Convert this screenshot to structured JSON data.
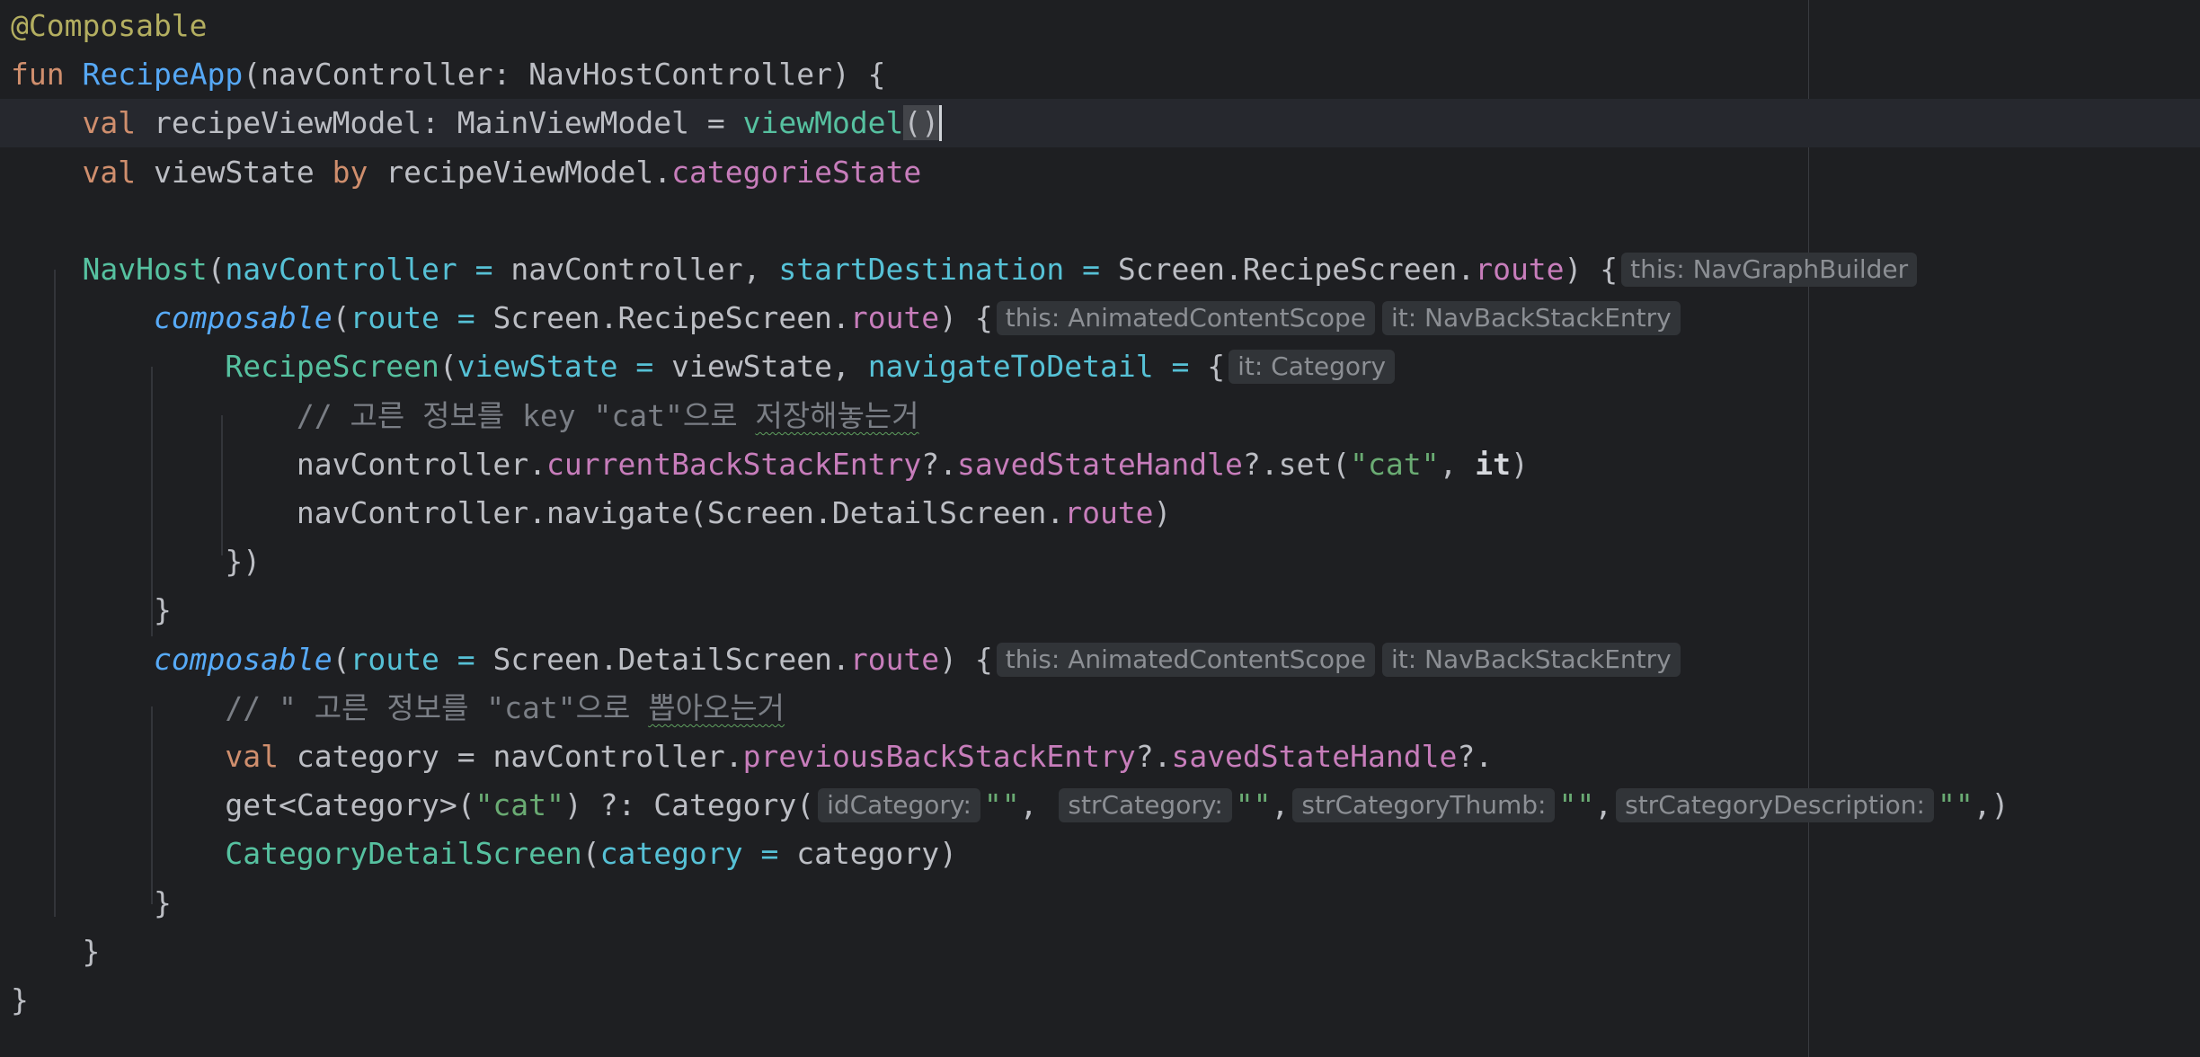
{
  "editor": {
    "language": "Kotlin",
    "theme": "dark",
    "colors": {
      "background": "#1e1f22",
      "current_line": "#26282e",
      "annotation": "#b3ae60",
      "keyword": "#cf8e6d",
      "function_declaration": "#56a8f5",
      "function_call": "#57aaf7",
      "composable_call": "#56c1a0",
      "property": "#c77dbb",
      "named_argument": "#56c1d6",
      "string": "#6aab73",
      "comment": "#7a7e85",
      "inlay_hint_bg": "#313438"
    },
    "lines": [
      [
        {
          "t": "@Composable",
          "c": "ann"
        }
      ],
      [
        {
          "t": "fun ",
          "c": "kw"
        },
        {
          "t": "RecipeApp",
          "c": "fndecl"
        },
        {
          "t": "(navController: NavHostController) {",
          "c": ""
        }
      ],
      [
        {
          "t": "    ",
          "c": ""
        },
        {
          "t": "val ",
          "c": "kw"
        },
        {
          "t": "recipeViewModel: MainViewModel = ",
          "c": ""
        },
        {
          "t": "viewModel",
          "c": "composecall"
        },
        {
          "t": "()",
          "c": "paren-match"
        },
        {
          "t": "",
          "c": "caret"
        }
      ],
      [
        {
          "t": "    ",
          "c": ""
        },
        {
          "t": "val ",
          "c": "kw"
        },
        {
          "t": "viewState ",
          "c": ""
        },
        {
          "t": "by ",
          "c": "kw"
        },
        {
          "t": "recipeViewModel.",
          "c": ""
        },
        {
          "t": "categorieState",
          "c": "prop"
        }
      ],
      [],
      [
        {
          "t": "    ",
          "c": ""
        },
        {
          "t": "NavHost",
          "c": "composecall"
        },
        {
          "t": "(",
          "c": ""
        },
        {
          "t": "navController = ",
          "c": "param"
        },
        {
          "t": "navController, ",
          "c": ""
        },
        {
          "t": "startDestination = ",
          "c": "param"
        },
        {
          "t": "Screen.RecipeScreen.",
          "c": ""
        },
        {
          "t": "route",
          "c": "prop"
        },
        {
          "t": ") {",
          "c": ""
        },
        {
          "t": "this: NavGraphBuilder",
          "c": "hint"
        }
      ],
      [
        {
          "t": "        ",
          "c": ""
        },
        {
          "t": "composable",
          "c": "fncall"
        },
        {
          "t": "(",
          "c": ""
        },
        {
          "t": "route = ",
          "c": "param"
        },
        {
          "t": "Screen.RecipeScreen.",
          "c": ""
        },
        {
          "t": "route",
          "c": "prop"
        },
        {
          "t": ") {",
          "c": ""
        },
        {
          "t": "this: AnimatedContentScope",
          "c": "hint"
        },
        {
          "t": "it: NavBackStackEntry",
          "c": "hint"
        }
      ],
      [
        {
          "t": "            ",
          "c": ""
        },
        {
          "t": "RecipeScreen",
          "c": "composecall"
        },
        {
          "t": "(",
          "c": ""
        },
        {
          "t": "viewState = ",
          "c": "param"
        },
        {
          "t": "viewState, ",
          "c": ""
        },
        {
          "t": "navigateToDetail = ",
          "c": "param"
        },
        {
          "t": "{",
          "c": ""
        },
        {
          "t": "it: Category",
          "c": "hint"
        }
      ],
      [
        {
          "t": "                ",
          "c": ""
        },
        {
          "t": "// 고른 정보를 key \"cat\"으로 ",
          "c": "cmt"
        },
        {
          "t": "저장해놓는거",
          "c": "cmt typo"
        }
      ],
      [
        {
          "t": "                navController.",
          "c": ""
        },
        {
          "t": "currentBackStackEntry",
          "c": "prop"
        },
        {
          "t": "?.",
          "c": ""
        },
        {
          "t": "savedStateHandle",
          "c": "prop"
        },
        {
          "t": "?.set(",
          "c": ""
        },
        {
          "t": "\"cat\"",
          "c": "str"
        },
        {
          "t": ", ",
          "c": ""
        },
        {
          "t": "it",
          "c": "bold"
        },
        {
          "t": ")",
          "c": ""
        }
      ],
      [
        {
          "t": "                navController.navigate(Screen.DetailScreen.",
          "c": ""
        },
        {
          "t": "route",
          "c": "prop"
        },
        {
          "t": ")",
          "c": ""
        }
      ],
      [
        {
          "t": "            })",
          "c": ""
        }
      ],
      [
        {
          "t": "        }",
          "c": ""
        }
      ],
      [
        {
          "t": "        ",
          "c": ""
        },
        {
          "t": "composable",
          "c": "fncall"
        },
        {
          "t": "(",
          "c": ""
        },
        {
          "t": "route = ",
          "c": "param"
        },
        {
          "t": "Screen.DetailScreen.",
          "c": ""
        },
        {
          "t": "route",
          "c": "prop"
        },
        {
          "t": ") {",
          "c": ""
        },
        {
          "t": "this: AnimatedContentScope",
          "c": "hint"
        },
        {
          "t": "it: NavBackStackEntry",
          "c": "hint"
        }
      ],
      [
        {
          "t": "            ",
          "c": ""
        },
        {
          "t": "// \" 고른 정보를 \"cat\"으로 ",
          "c": "cmt"
        },
        {
          "t": "뽑아오는거",
          "c": "cmt typo"
        }
      ],
      [
        {
          "t": "            ",
          "c": ""
        },
        {
          "t": "val ",
          "c": "kw"
        },
        {
          "t": "category = navController.",
          "c": ""
        },
        {
          "t": "previousBackStackEntry",
          "c": "prop"
        },
        {
          "t": "?.",
          "c": ""
        },
        {
          "t": "savedStateHandle",
          "c": "prop"
        },
        {
          "t": "?.",
          "c": ""
        }
      ],
      [
        {
          "t": "            get<Category>(",
          "c": ""
        },
        {
          "t": "\"cat\"",
          "c": "str"
        },
        {
          "t": ") ?: Category(",
          "c": ""
        },
        {
          "t": "idCategory:",
          "c": "hint"
        },
        {
          "t": "\"\"",
          "c": "str"
        },
        {
          "t": ", ",
          "c": ""
        },
        {
          "t": "strCategory:",
          "c": "hint"
        },
        {
          "t": "\"\"",
          "c": "str"
        },
        {
          "t": ",",
          "c": ""
        },
        {
          "t": "strCategoryThumb:",
          "c": "hint"
        },
        {
          "t": "\"\"",
          "c": "str"
        },
        {
          "t": ",",
          "c": ""
        },
        {
          "t": "strCategoryDescription:",
          "c": "hint"
        },
        {
          "t": "\"\"",
          "c": "str"
        },
        {
          "t": ",)",
          "c": ""
        }
      ],
      [
        {
          "t": "            ",
          "c": ""
        },
        {
          "t": "CategoryDetailScreen",
          "c": "composecall"
        },
        {
          "t": "(",
          "c": ""
        },
        {
          "t": "category = ",
          "c": "param"
        },
        {
          "t": "category)",
          "c": ""
        }
      ],
      [
        {
          "t": "        }",
          "c": ""
        }
      ],
      [
        {
          "t": "    }",
          "c": ""
        }
      ],
      [
        {
          "t": "}",
          "c": ""
        }
      ]
    ]
  }
}
